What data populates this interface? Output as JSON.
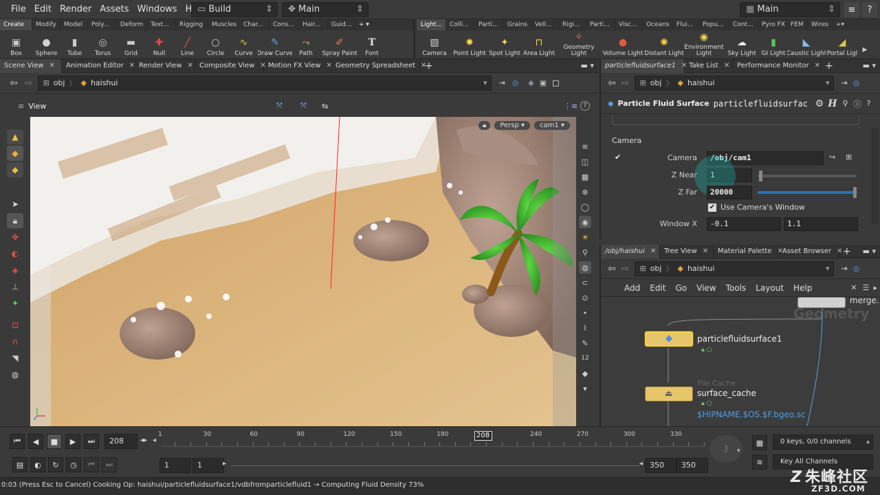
{
  "menubar": {
    "items": [
      "File",
      "Edit",
      "Render",
      "Assets",
      "Windows",
      "Help"
    ],
    "desktop": "Build",
    "context": "Main",
    "desk_right": "Main"
  },
  "shelf": {
    "left_tabs": [
      "Create",
      "Modify",
      "Model",
      "Poly...",
      "Deform",
      "Text...",
      "Rigging",
      "Muscles",
      "Char...",
      "Cons...",
      "Hair...",
      "Guid..."
    ],
    "right_tabs": [
      "Light...",
      "Colli...",
      "Parti...",
      "Grains",
      "Vell...",
      "Rigi...",
      "Parti...",
      "Visc...",
      "Oceans",
      "Flui...",
      "Popu...",
      "Cont...",
      "Pyro FX",
      "FEM",
      "Wires"
    ],
    "left_tools": [
      {
        "label": "Box",
        "icon": "box-icon"
      },
      {
        "label": "Sphere",
        "icon": "sphere-icon"
      },
      {
        "label": "Tube",
        "icon": "tube-icon"
      },
      {
        "label": "Torus",
        "icon": "torus-icon"
      },
      {
        "label": "Grid",
        "icon": "grid-icon"
      },
      {
        "label": "Null",
        "icon": "null-icon"
      },
      {
        "label": "Line",
        "icon": "line-icon"
      },
      {
        "label": "Circle",
        "icon": "circle-icon"
      },
      {
        "label": "Curve",
        "icon": "curve-icon"
      },
      {
        "label": "Draw Curve",
        "icon": "draw-curve-icon"
      },
      {
        "label": "Path",
        "icon": "path-icon"
      },
      {
        "label": "Spray Paint",
        "icon": "spray-paint-icon"
      },
      {
        "label": "Font",
        "icon": "font-icon"
      }
    ],
    "right_tools": [
      {
        "label": "Camera",
        "icon": "camera-icon"
      },
      {
        "label": "Point Light",
        "icon": "point-light-icon"
      },
      {
        "label": "Spot Light",
        "icon": "spot-light-icon"
      },
      {
        "label": "Area Light",
        "icon": "area-light-icon"
      },
      {
        "label": "Geometry Light",
        "icon": "geometry-light-icon"
      },
      {
        "label": "Volume Light",
        "icon": "volume-light-icon"
      },
      {
        "label": "Distant Light",
        "icon": "distant-light-icon"
      },
      {
        "label": "Environment Light",
        "icon": "environment-light-icon"
      },
      {
        "label": "Sky Light",
        "icon": "sky-light-icon"
      },
      {
        "label": "GI Light",
        "icon": "gi-light-icon"
      },
      {
        "label": "Caustic Light",
        "icon": "caustic-light-icon"
      },
      {
        "label": "Portal Ligl",
        "icon": "portal-light-icon"
      }
    ]
  },
  "left_pane": {
    "tabs": [
      "Scene View",
      "Animation Editor",
      "Render View",
      "Composite View",
      "Motion FX View",
      "Geometry Spreadsheet"
    ],
    "path": [
      "obj",
      "haishui"
    ],
    "view_label": "View",
    "persp": "Persp",
    "cam": "cam1"
  },
  "param_pane": {
    "tabs": [
      "particlefluidsurface1",
      "Take List",
      "Performance Monitor"
    ],
    "path": [
      "obj",
      "haishui"
    ],
    "node_type": "Particle Fluid Surface",
    "node_name": "particlefluidsurfac",
    "section": "Camera",
    "camera_label": "Camera",
    "camera_value": "/obj/cam1",
    "znear_label": "Z Near",
    "znear_value": "1",
    "znear_level": 0.03,
    "zfar_label": "Z Far",
    "zfar_value": "20000",
    "zfar_level": 1.0,
    "use_window_label": "Use Camera's Window",
    "windowx_label": "Window X",
    "windowx_min": "-0.1",
    "windowx_max": "1.1"
  },
  "network_pane": {
    "tabs": [
      "/obj/haishui",
      "Tree View",
      "Material Palette",
      "Asset Browser"
    ],
    "path": [
      "obj",
      "haishui"
    ],
    "menu": [
      "Add",
      "Edit",
      "Go",
      "View",
      "Tools",
      "Layout",
      "Help"
    ],
    "watermark": "Geometry",
    "nodes": {
      "merge": "merge...",
      "pfs": "particlefluidsurface1",
      "cache_type": "File Cache",
      "cache_name": "surface_cache",
      "cache_path": "$HIPNAME.$OS.$F.bgeo.sc"
    }
  },
  "timeline": {
    "frame": "208",
    "ticks": [
      "1",
      "30",
      "60",
      "90",
      "120",
      "150",
      "180",
      "240",
      "270",
      "300",
      "330"
    ],
    "current": "208",
    "start": "1",
    "start2": "1",
    "end": "350",
    "end2": "350",
    "keys_label": "0 keys, 0/0 channels",
    "key_all": "Key All Channels"
  },
  "status": {
    "text": "0:03 (Press Esc to Cancel) Cooking Op: haishui/particlefluidsurface1/vdbfromparticlefluid1 → Computing Fluid Density 73%"
  },
  "watermark": {
    "brand": "朱峰社区",
    "url": "ZF3D.COM"
  }
}
